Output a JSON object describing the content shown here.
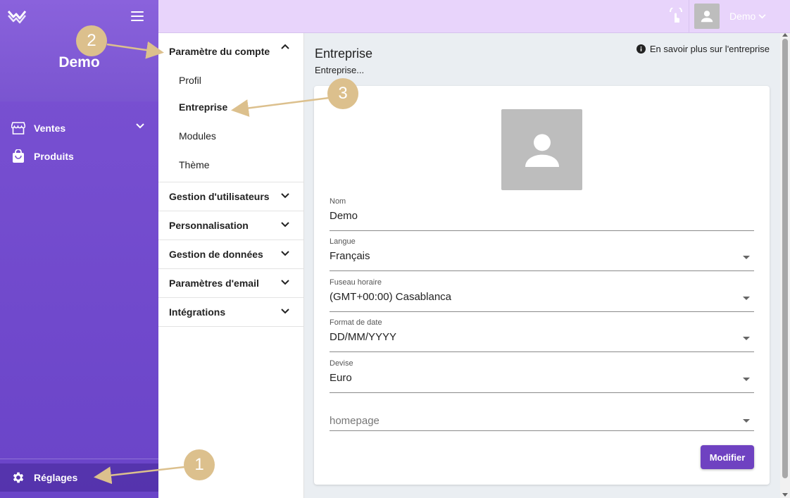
{
  "sidebar": {
    "brand": "Demo",
    "items": [
      {
        "label": "Ventes"
      },
      {
        "label": "Produits"
      }
    ],
    "settings_label": "Réglages"
  },
  "topbar": {
    "user_name": "Demo"
  },
  "submenu": {
    "sections": [
      {
        "label": "Paramètre du compte",
        "items": [
          {
            "label": "Profil"
          },
          {
            "label": "Entreprise"
          },
          {
            "label": "Modules"
          },
          {
            "label": "Thème"
          }
        ]
      },
      {
        "label": "Gestion d'utilisateurs"
      },
      {
        "label": "Personnalisation"
      },
      {
        "label": "Gestion de données"
      },
      {
        "label": "Paramètres d'email"
      },
      {
        "label": "Intégrations"
      }
    ]
  },
  "main": {
    "title": "Entreprise",
    "subtitle": "Entreprise...",
    "info_link": "En savoir plus sur l'entreprise",
    "fields": {
      "nom": {
        "label": "Nom",
        "value": "Demo"
      },
      "langue": {
        "label": "Langue",
        "value": "Français"
      },
      "fuseau": {
        "label": "Fuseau horaire",
        "value": "(GMT+00:00) Casablanca"
      },
      "format_date": {
        "label": "Format de date",
        "value": "DD/MM/YYYY"
      },
      "devise": {
        "label": "Devise",
        "value": "Euro"
      },
      "homepage": {
        "placeholder": "homepage"
      }
    },
    "submit_label": "Modifier"
  },
  "annotations": [
    "1",
    "2",
    "3"
  ],
  "colors": {
    "sidebar": "#7b52d3",
    "topbar": "#e8d4fb",
    "accent": "#6f42c1",
    "badge": "#dcc08d"
  }
}
